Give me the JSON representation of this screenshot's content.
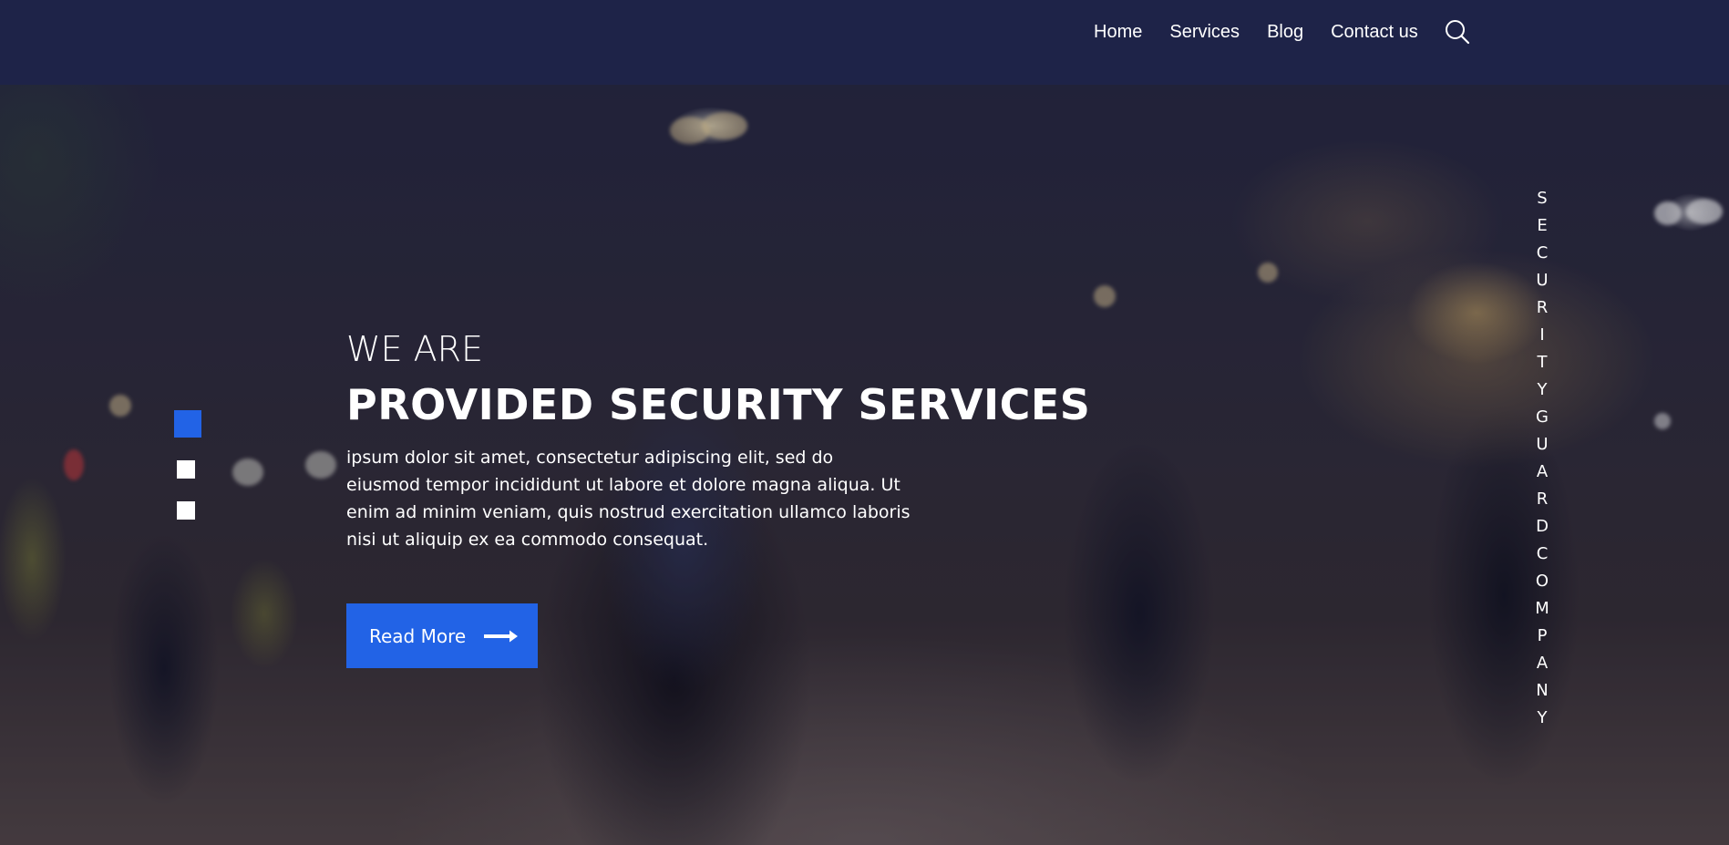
{
  "nav": {
    "items": [
      {
        "label": "Home"
      },
      {
        "label": "Services"
      },
      {
        "label": "Blog"
      },
      {
        "label": "Contact us"
      }
    ],
    "search_icon": "search-icon"
  },
  "hero": {
    "kicker": "WE ARE",
    "title": "PROVIDED SECURITY SERVICES",
    "description": "ipsum dolor sit amet, consectetur adipiscing elit, sed do eiusmod tempor incididunt ut labore et dolore magna aliqua. Ut enim ad minim veniam, quis nostrud exercitation ullamco laboris nisi ut aliquip ex ea commodo consequat.",
    "cta_label": "Read More",
    "cta_icon": "arrow-right-icon",
    "slider": {
      "count": 3,
      "active": 1
    },
    "side_text": "SECURITYGUARDCOMPANY"
  },
  "colors": {
    "nav_bg": "#1e2348",
    "accent": "#2263e6",
    "text": "#ffffff"
  }
}
